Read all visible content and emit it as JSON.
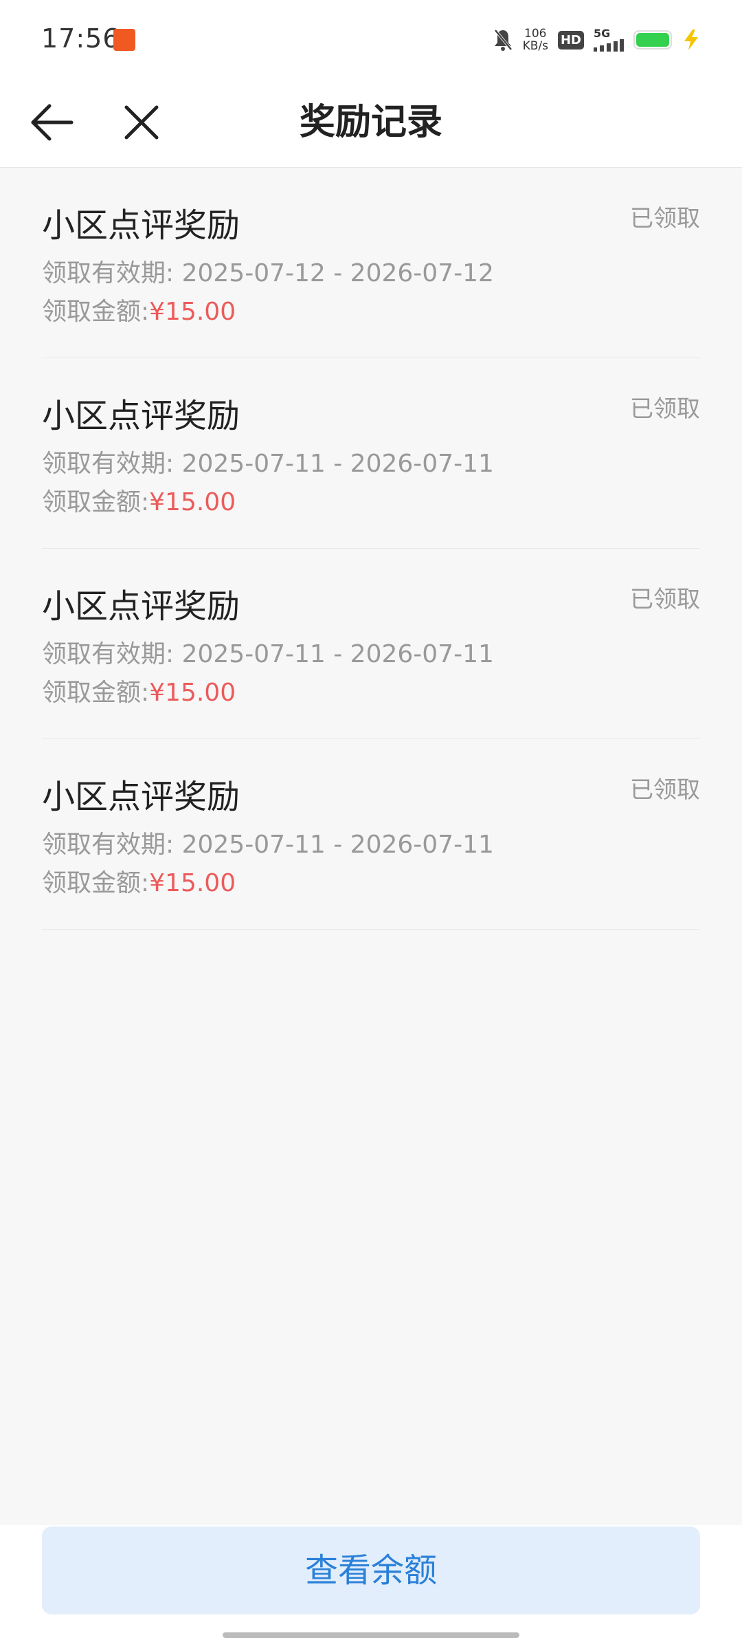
{
  "status_bar": {
    "time": "17:56",
    "net_speed_value": "106",
    "net_speed_unit": "KB/s",
    "hd_label": "HD",
    "network_label": "5G"
  },
  "header": {
    "title": "奖励记录",
    "back_icon": "arrow-left-icon",
    "close_icon": "close-icon"
  },
  "records": [
    {
      "title": "小区点评奖励",
      "status": "已领取",
      "validity_label": "领取有效期:",
      "validity": "2025-07-12 - 2026-07-12",
      "amount_label": "领取金额:",
      "amount": "¥15.00"
    },
    {
      "title": "小区点评奖励",
      "status": "已领取",
      "validity_label": "领取有效期:",
      "validity": "2025-07-11 - 2026-07-11",
      "amount_label": "领取金额:",
      "amount": "¥15.00"
    },
    {
      "title": "小区点评奖励",
      "status": "已领取",
      "validity_label": "领取有效期:",
      "validity": "2025-07-11 - 2026-07-11",
      "amount_label": "领取金额:",
      "amount": "¥15.00"
    },
    {
      "title": "小区点评奖励",
      "status": "已领取",
      "validity_label": "领取有效期:",
      "validity": "2025-07-11 - 2026-07-11",
      "amount_label": "领取金额:",
      "amount": "¥15.00"
    }
  ],
  "footer": {
    "button_label": "查看余额"
  },
  "colors": {
    "amount": "#ec5b5b",
    "button_text": "#2a80d8",
    "button_bg": "#e2eefb"
  }
}
